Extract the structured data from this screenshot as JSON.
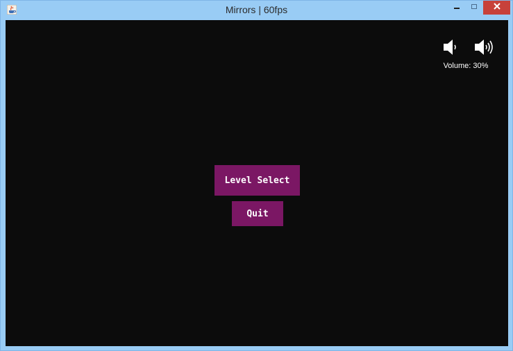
{
  "window": {
    "title": "Mirrors  |  60fps",
    "app_icon": "java-cup-icon",
    "controls": {
      "minimize": "minimize-icon",
      "maximize": "maximize-icon",
      "close": "close-icon",
      "close_color": "#c7413a"
    }
  },
  "game": {
    "background_color": "#0c0c0c",
    "volume": {
      "down_icon": "volume-down-icon",
      "up_icon": "volume-up-icon",
      "label": "Volume: 30%"
    },
    "menu": {
      "button_color": "#7b1764",
      "level_select_label": "Level Select",
      "quit_label": "Quit"
    }
  }
}
